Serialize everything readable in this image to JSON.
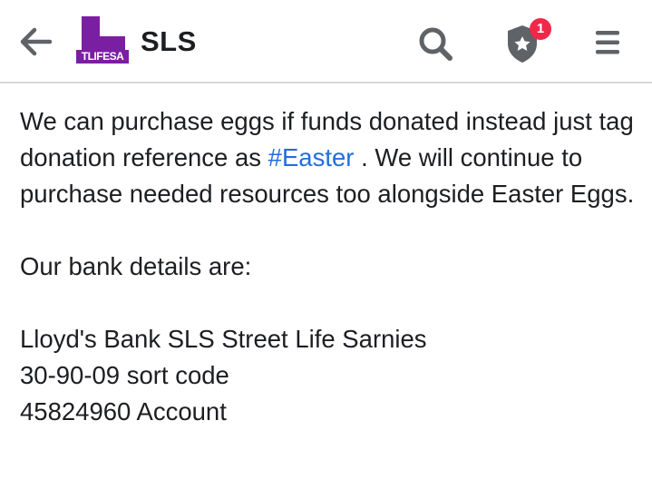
{
  "header": {
    "page_name": "SLS",
    "avatar_caption": "TLIFESA",
    "notification_count": "1",
    "accent_color": "#7b1fa2",
    "badge_color": "#f02849"
  },
  "icons": {
    "back": "arrow-left-icon",
    "search": "search-icon",
    "shortcuts": "shield-star-icon",
    "menu": "hamburger-menu-icon"
  },
  "post": {
    "para1_before": "We can purchase eggs if funds donated instead just tag donation reference as ",
    "hashtag": "#Easter",
    "para1_after": " . We will continue to purchase needed resources too alongside Easter Eggs.",
    "para2": "Our bank details are:",
    "bank_line": "Lloyd's Bank SLS Street Life Sarnies",
    "sort_code_line": "30-90-09 sort code",
    "account_line": "45824960 Account"
  }
}
